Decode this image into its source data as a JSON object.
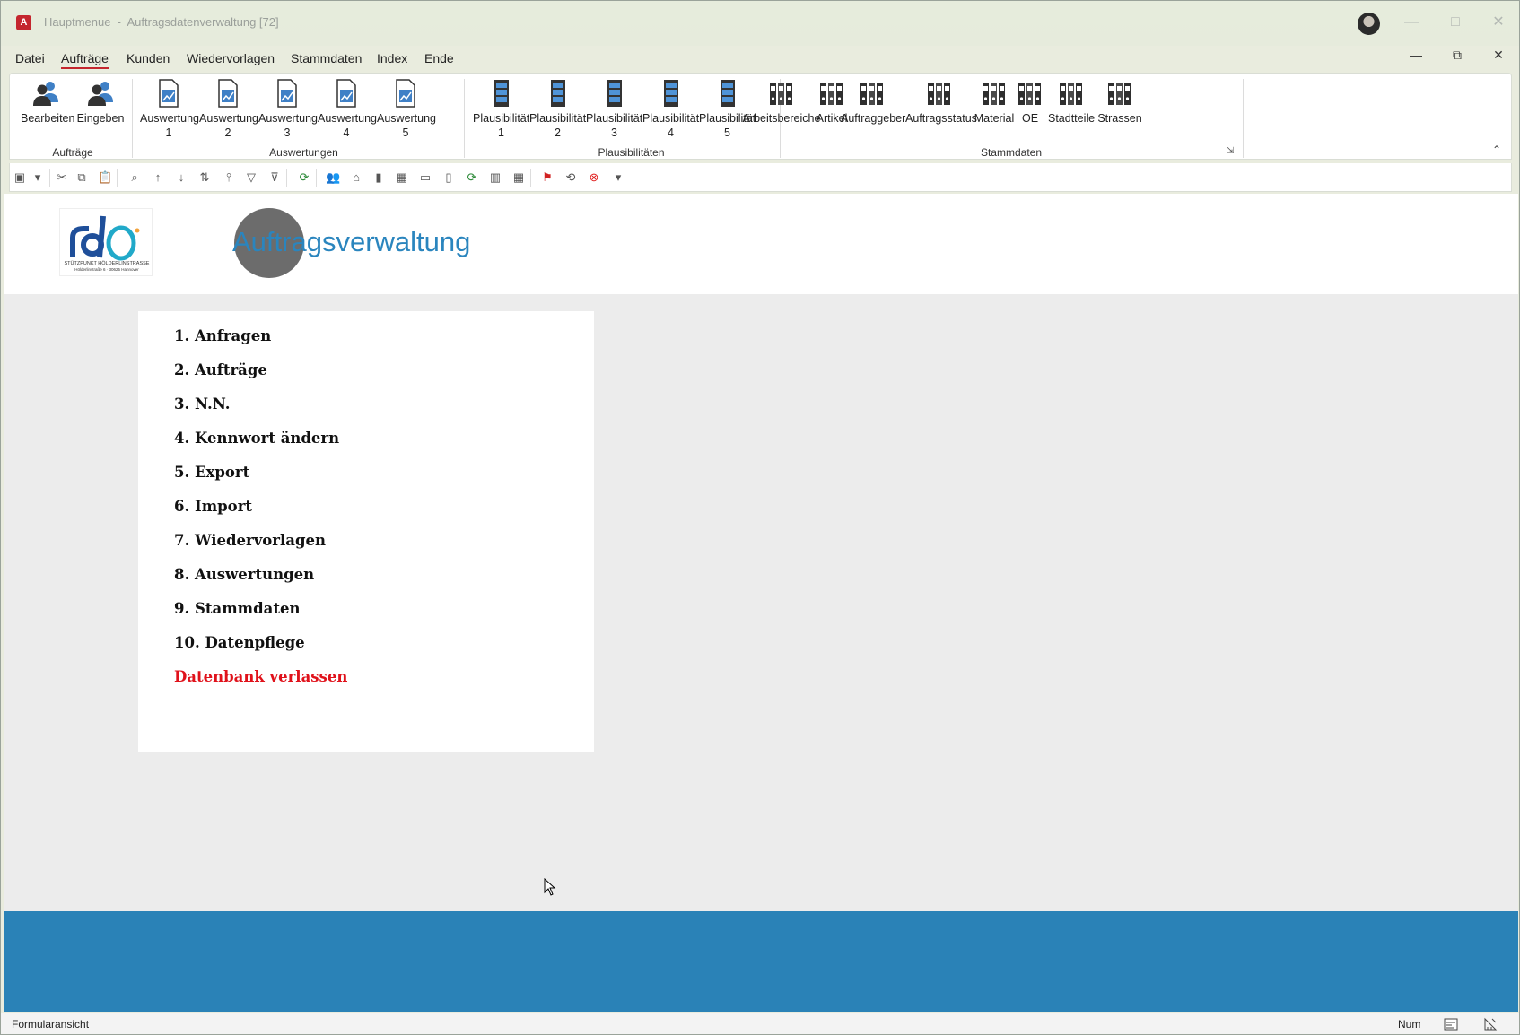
{
  "window": {
    "title": "Hauptmenue  -  Auftragsdatenverwaltung [72]",
    "app_icon": "A"
  },
  "menu": [
    {
      "label": "Datei"
    },
    {
      "label": "Aufträge",
      "active": true
    },
    {
      "label": "Kunden"
    },
    {
      "label": "Wiedervorlagen"
    },
    {
      "label": "Stammdaten"
    },
    {
      "label": "Index"
    },
    {
      "label": "Ende"
    }
  ],
  "ribbon": {
    "auftraege": {
      "label": "Aufträge",
      "buttons": [
        {
          "label": "Bearbeiten",
          "icon": "users-icon"
        },
        {
          "label": "Eingeben",
          "icon": "users-icon"
        }
      ]
    },
    "auswertungen": {
      "label": "Auswertungen",
      "buttons": [
        {
          "l1": "Auswertung",
          "l2": "1"
        },
        {
          "l1": "Auswertung",
          "l2": "2"
        },
        {
          "l1": "Auswertung",
          "l2": "3"
        },
        {
          "l1": "Auswertung",
          "l2": "4"
        },
        {
          "l1": "Auswertung",
          "l2": "5"
        }
      ]
    },
    "plausibilitaeten": {
      "label": "Plausibilitäten",
      "buttons": [
        {
          "l1": "Plausibilität",
          "l2": "1"
        },
        {
          "l1": "Plausibilität",
          "l2": "2"
        },
        {
          "l1": "Plausibilität",
          "l2": "3"
        },
        {
          "l1": "Plausibilität",
          "l2": "4"
        },
        {
          "l1": "Plausibilität",
          "l2": "5"
        }
      ]
    },
    "stammdaten": {
      "label": "Stammdaten",
      "buttons": [
        {
          "label": "Arbeitsbereiche"
        },
        {
          "label": "Artikel"
        },
        {
          "label": "Auftraggeber"
        },
        {
          "label": "Auftragsstatus"
        },
        {
          "label": "Material"
        },
        {
          "label": "OE"
        },
        {
          "label": "Stadtteile"
        },
        {
          "label": "Strassen"
        }
      ]
    }
  },
  "form": {
    "title": "Auftragsverwaltung",
    "logo_text": "STÜTZPUNKT HÖLDERLINSTRASSE",
    "logo_subtext": "Hölderlinstraße 6 · 30625 Hannover",
    "items": [
      "1. Anfragen",
      "2. Aufträge",
      "3. N.N.",
      "4. Kennwort ändern",
      "5. Export",
      "6. Import",
      "7. Wiedervorlagen",
      "8. Auswertungen",
      "9. Stammdaten",
      "10. Datenpflege"
    ],
    "exit": "Datenbank verlassen",
    "colors": {
      "title": "#2a85be",
      "exit": "#e0121b",
      "footer": "#2a82b7"
    }
  },
  "status": {
    "left": "Formularansicht",
    "num": "Num"
  }
}
